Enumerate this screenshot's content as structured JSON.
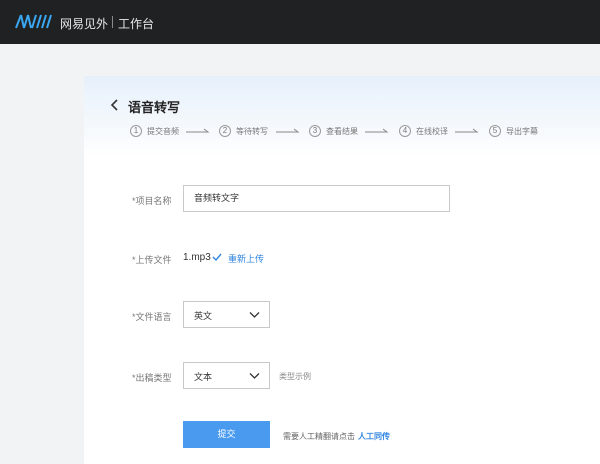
{
  "header": {
    "brand": "网易见外",
    "workbench": "工作台"
  },
  "page": {
    "title": "语音转写"
  },
  "steps": [
    {
      "num": "1",
      "label": "提交音频"
    },
    {
      "num": "2",
      "label": "等待转写"
    },
    {
      "num": "3",
      "label": "查看结果"
    },
    {
      "num": "4",
      "label": "在线校译"
    },
    {
      "num": "5",
      "label": "导出字幕"
    }
  ],
  "form": {
    "project_name_label": "*项目名称",
    "project_name_value": "音频转文字",
    "upload_label": "*上传文件",
    "file_name": "1.mp3",
    "reupload": "重新上传",
    "language_label": "*文件语言",
    "language_value": "英文",
    "output_label": "*出稿类型",
    "output_value": "文本",
    "output_example": "类型示例",
    "submit": "提交",
    "hint": "需要人工精翻请点击",
    "hint_link": "人工同传"
  },
  "colors": {
    "topbar": "#202122",
    "accent": "#2f84e0",
    "submit": "#4a9bf0"
  }
}
